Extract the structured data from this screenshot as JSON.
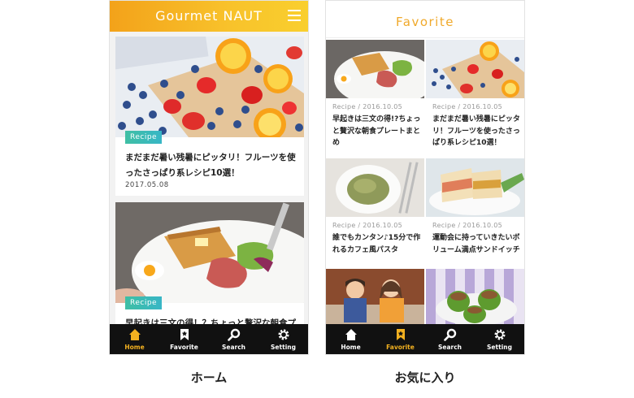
{
  "home_screen": {
    "header": {
      "title": "Gourmet NAUT"
    },
    "cards": [
      {
        "tag": "Recipe",
        "title": "まだまだ暑い残暑にピッタリ！フルーツを使ったさっぱり系レシピ10選！",
        "date": "2017.05.08"
      },
      {
        "tag": "Recipe",
        "title": "早起きは三文の得！？ちょっと贅沢な朝食プレートまとめ"
      }
    ],
    "caption": "ホーム"
  },
  "favorite_screen": {
    "header": {
      "title": "Favorite"
    },
    "items": [
      {
        "meta": "Recipe / 2016.10.05",
        "title": "早起きは三文の得!?ちょっと贅沢な朝食プレートまとめ"
      },
      {
        "meta": "Recipe / 2016.10.05",
        "title": "まだまだ暑い残暑にピッタリ！フルーツを使ったさっぱり系レシピ10選！"
      },
      {
        "meta": "Recipe / 2016.10.05",
        "title": "誰でもカンタン♪15分で作れるカフェ風パスタ"
      },
      {
        "meta": "Recipe / 2016.10.05",
        "title": "運動会に持っていきたいボリューム満点サンドイッチ"
      }
    ],
    "caption": "お気に入り"
  },
  "tabbar": {
    "tabs": [
      {
        "label": "Home",
        "icon": "home-icon"
      },
      {
        "label": "Favorite",
        "icon": "bookmark-icon"
      },
      {
        "label": "Search",
        "icon": "search-icon"
      },
      {
        "label": "Setting",
        "icon": "gear-icon"
      }
    ],
    "active_color": "#f3b120"
  },
  "colors": {
    "accent_gradient_start": "#f3a21a",
    "accent_gradient_end": "#f9cf2e",
    "tag_color": "#3fbfa4",
    "favorite_title": "#f0a92a"
  }
}
